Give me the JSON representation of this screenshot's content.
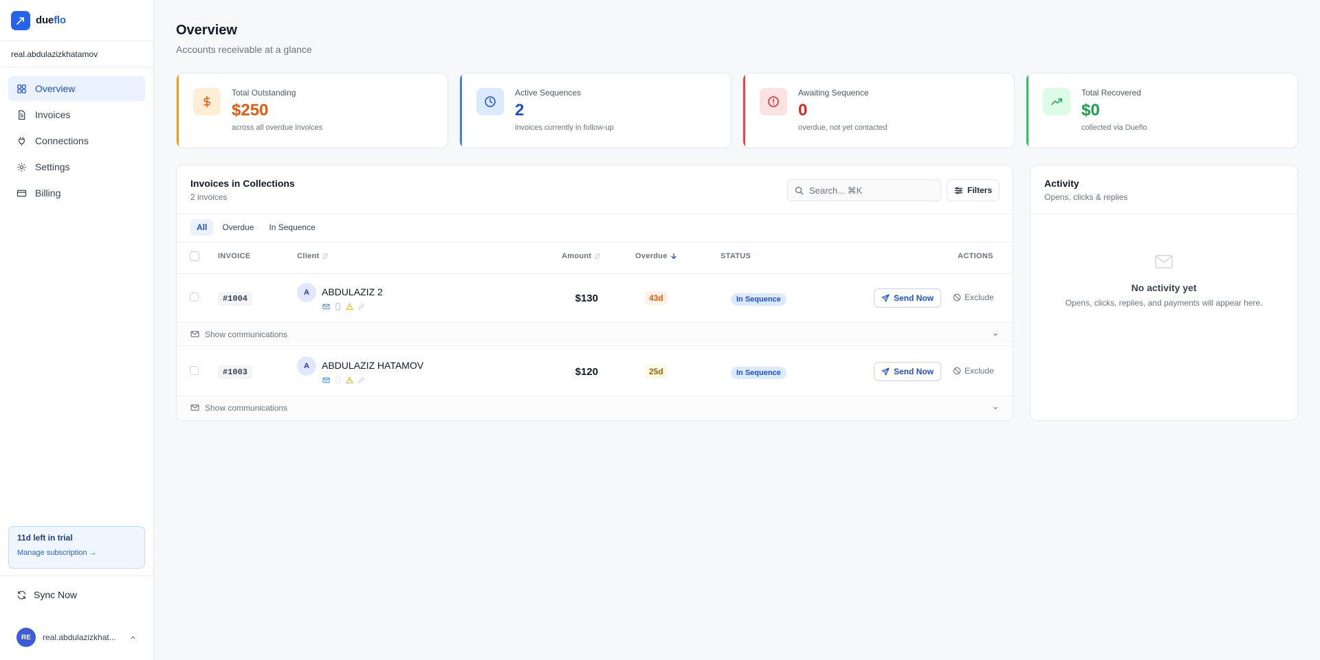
{
  "brand": {
    "name_part1": "due",
    "name_part2": "flo"
  },
  "workspace": {
    "name": "real.abdulazizkhatamov"
  },
  "sidebar": {
    "items": [
      {
        "label": "Overview",
        "icon": "grid-icon",
        "active": true
      },
      {
        "label": "Invoices",
        "icon": "file-text-icon",
        "active": false
      },
      {
        "label": "Connections",
        "icon": "plug-icon",
        "active": false
      },
      {
        "label": "Settings",
        "icon": "gear-icon",
        "active": false
      },
      {
        "label": "Billing",
        "icon": "credit-card-icon",
        "active": false
      }
    ],
    "trial": {
      "title": "11d left in trial",
      "link": "Manage subscription →"
    },
    "sync_label": "Sync Now",
    "user": {
      "initials": "RE",
      "name": "real.abdulazizkhat..."
    }
  },
  "page": {
    "title": "Overview",
    "subtitle": "Accounts receivable at a glance"
  },
  "stats": [
    {
      "label": "Total Outstanding",
      "value": "$250",
      "caption": "across all overdue invoices",
      "color": "#ea580c",
      "bg": "#ffedd5",
      "bar": "#f59e0b",
      "icon": "dollar-icon"
    },
    {
      "label": "Active Sequences",
      "value": "2",
      "caption": "invoices currently in follow-up",
      "color": "#1d4ed8",
      "bg": "#dbeafe",
      "bar": "#3b82f6",
      "icon": "clock-icon"
    },
    {
      "label": "Awaiting Sequence",
      "value": "0",
      "caption": "overdue, not yet contacted",
      "color": "#dc2626",
      "bg": "#fee2e2",
      "bar": "#ef4444",
      "icon": "alert-circle-icon"
    },
    {
      "label": "Total Recovered",
      "value": "$0",
      "caption": "collected via Dueflo",
      "color": "#16a34a",
      "bg": "#dcfce7",
      "bar": "#22c55e",
      "icon": "trending-up-icon"
    }
  ],
  "invoices": {
    "title": "Invoices in Collections",
    "count": "2 invoices",
    "search_placeholder": "Search... ⌘K",
    "filters_label": "Filters",
    "tabs": [
      {
        "label": "All",
        "active": true
      },
      {
        "label": "Overdue",
        "active": false
      },
      {
        "label": "In Sequence",
        "active": false
      }
    ],
    "columns": {
      "invoice": "INVOICE",
      "client": "Client",
      "amount": "Amount",
      "overdue": "Overdue",
      "status": "STATUS",
      "actions": "ACTIONS"
    },
    "rows": [
      {
        "number": "#1004",
        "avatar": "A",
        "client": "ABDULAZIZ 2",
        "amount": "$130",
        "overdue": "43d",
        "status": "In Sequence",
        "send": "Send Now",
        "exclude": "Exclude",
        "comms": "Show communications"
      },
      {
        "number": "#1003",
        "avatar": "A",
        "client": "ABDULAZIZ HATAMOV",
        "amount": "$120",
        "overdue": "25d",
        "status": "In Sequence",
        "send": "Send Now",
        "exclude": "Exclude",
        "comms": "Show communications"
      }
    ]
  },
  "activity": {
    "title": "Activity",
    "subtitle": "Opens, clicks & replies",
    "empty_title": "No activity yet",
    "empty_sub": "Opens, clicks, replies, and payments will appear here."
  }
}
